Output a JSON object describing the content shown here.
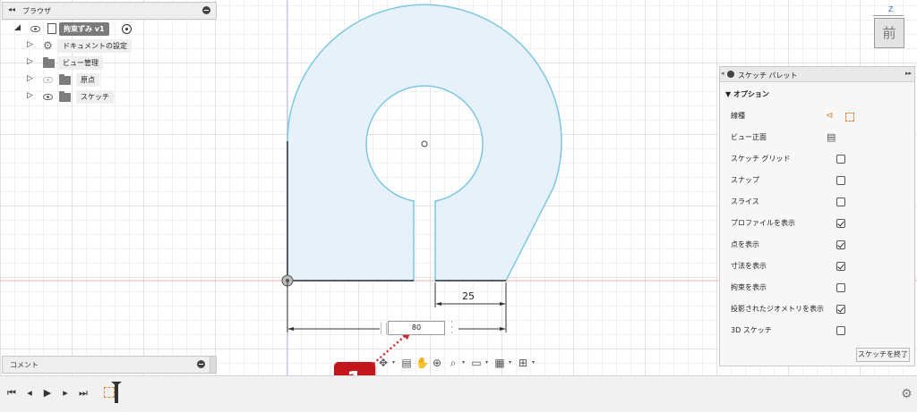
{
  "browser": {
    "title": "ブラウザ",
    "root_label": "拘束ずみ v1",
    "items": [
      {
        "label": "ドキュメントの設定"
      },
      {
        "label": "ビュー管理"
      },
      {
        "label": "原点"
      },
      {
        "label": "スケッチ"
      }
    ]
  },
  "comments": {
    "title": "コメント"
  },
  "viewcube": {
    "face_label": "前",
    "axis": "Z"
  },
  "sketch": {
    "dimension_width": "25",
    "dimension_input_value": "80",
    "profile_fill": "#e6f1fa",
    "profile_stroke": "#7cc7e3"
  },
  "palette": {
    "title": "スケッチ パレット",
    "section": "オプション",
    "options": [
      {
        "label": "線種",
        "control": "icons"
      },
      {
        "label": "ビュー正面",
        "control": "icon"
      },
      {
        "label": "スケッチ グリッド",
        "checked": false
      },
      {
        "label": "スナップ",
        "checked": false
      },
      {
        "label": "スライス",
        "checked": false
      },
      {
        "label": "プロファイルを表示",
        "checked": true
      },
      {
        "label": "点を表示",
        "checked": true
      },
      {
        "label": "寸法を表示",
        "checked": true
      },
      {
        "label": "拘束を表示",
        "checked": false
      },
      {
        "label": "投影されたジオメトリを表示",
        "checked": true
      },
      {
        "label": "3D スケッチ",
        "checked": false
      }
    ],
    "finish_button": "スケッチを終了"
  },
  "callout": {
    "number": "1",
    "color": "#c3161c"
  },
  "icons": {
    "timeline": [
      "skip-to-start-icon",
      "step-back-icon",
      "play-icon",
      "step-forward-icon",
      "skip-to-end-icon",
      "sketch-feature-icon",
      "settings-gear-icon"
    ],
    "toolbar": [
      "orbit-icon",
      "look-at-icon",
      "pan-icon",
      "zoom-icon",
      "zoom-window-icon",
      "display-settings-icon",
      "grid-icon",
      "viewports-icon"
    ]
  }
}
